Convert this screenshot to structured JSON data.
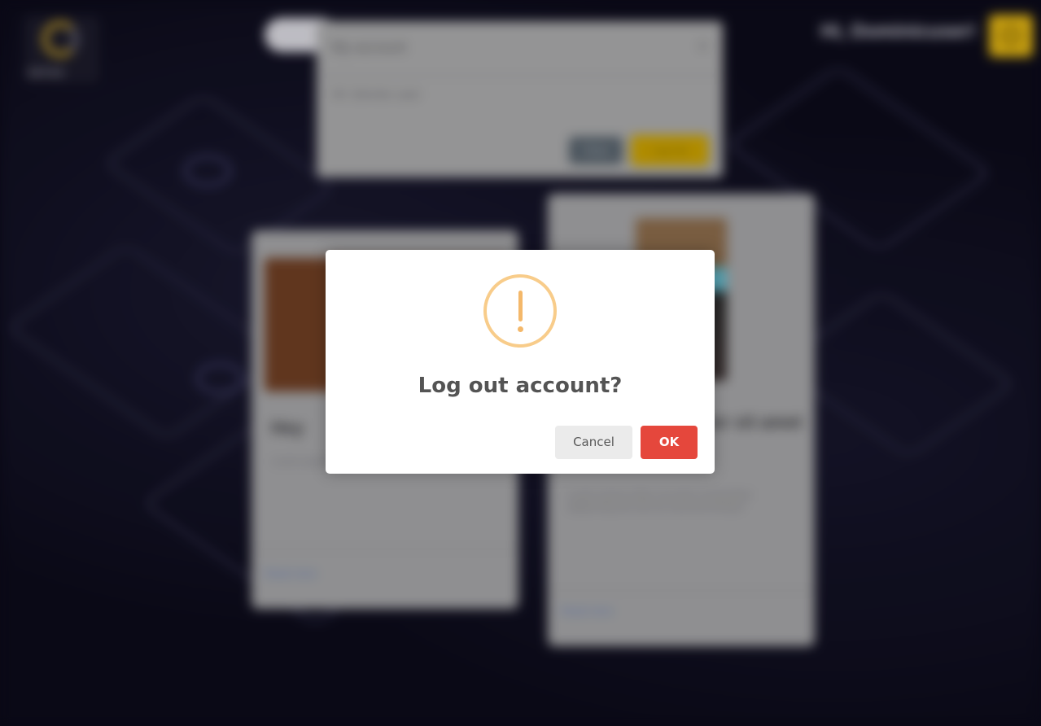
{
  "background": {
    "logo_text": "VATUX",
    "greeting": "Hi, Dominicuser!",
    "account_dialog": {
      "title": "My account",
      "message": "Hi! Jimmie user",
      "close_label": "Close",
      "logout_label": "Log Out"
    },
    "cards": [
      {
        "title": "Hey",
        "description": "Lorem ipsum dolor sit",
        "more": "Read more"
      },
      {
        "title": "Lorem ipsum dolor sit amet consectetur Ut",
        "description": "Lorem ipsum dolor sit amet consectetur adipiscing elit sed do eiusmod tempor",
        "more": "Read more"
      }
    ]
  },
  "modal": {
    "title": "Log out account?",
    "cancel_label": "Cancel",
    "ok_label": "OK",
    "icon": "warning-icon"
  },
  "colors": {
    "ok_button": "#e5473c",
    "cancel_button": "#ebebeb",
    "warning_icon": "#f8cc8a",
    "accent_yellow": "#e2b514"
  }
}
